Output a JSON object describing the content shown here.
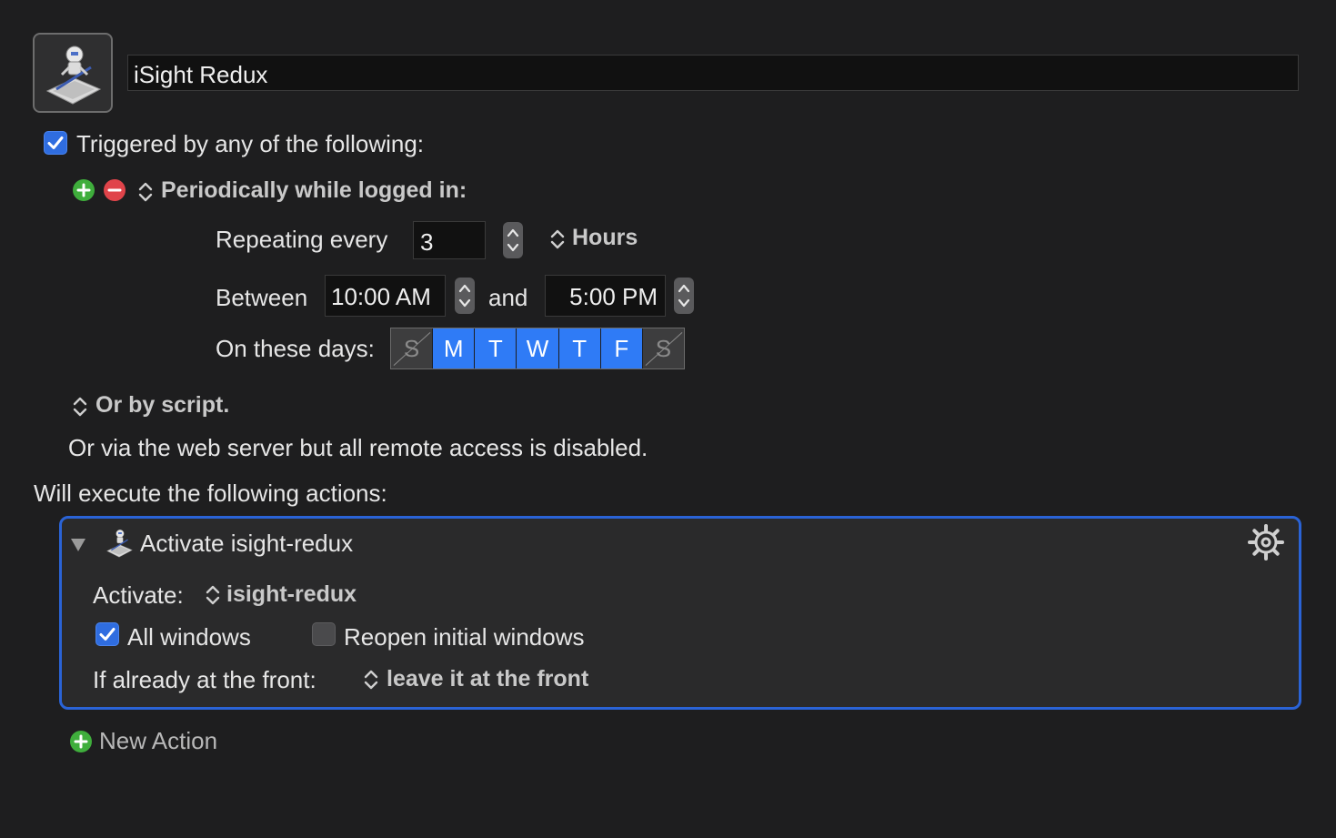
{
  "macro": {
    "name": "iSight Redux"
  },
  "trigger": {
    "triggered_label": "Triggered by any of the following:",
    "periodic_label": "Periodically while logged in:",
    "repeating_label": "Repeating every",
    "repeat_value": "3",
    "unit": "Hours",
    "between_label": "Between",
    "start_time": "10:00 AM",
    "and_label": "and",
    "end_time": "5:00 PM",
    "days_label": "On these days:",
    "days": [
      {
        "label": "S",
        "on": false
      },
      {
        "label": "M",
        "on": true
      },
      {
        "label": "T",
        "on": true
      },
      {
        "label": "W",
        "on": true
      },
      {
        "label": "T",
        "on": true
      },
      {
        "label": "F",
        "on": true
      },
      {
        "label": "S",
        "on": false
      }
    ],
    "script_label": "Or by script.",
    "web_server_text": "Or via the web server but all remote access is disabled."
  },
  "actions": {
    "header": "Will execute the following actions:",
    "action_title": "Activate isight-redux",
    "activate_label": "Activate:",
    "activate_target": "isight-redux",
    "all_windows_label": "All windows",
    "reopen_label": "Reopen initial windows",
    "front_label": "If already at the front:",
    "front_option": "leave it at the front",
    "new_action_label": "New Action"
  },
  "colors": {
    "background": "#1e1e1f",
    "accent_blue": "#2f7bf6",
    "add_green": "#3fae3c",
    "remove_red": "#e0444a"
  }
}
